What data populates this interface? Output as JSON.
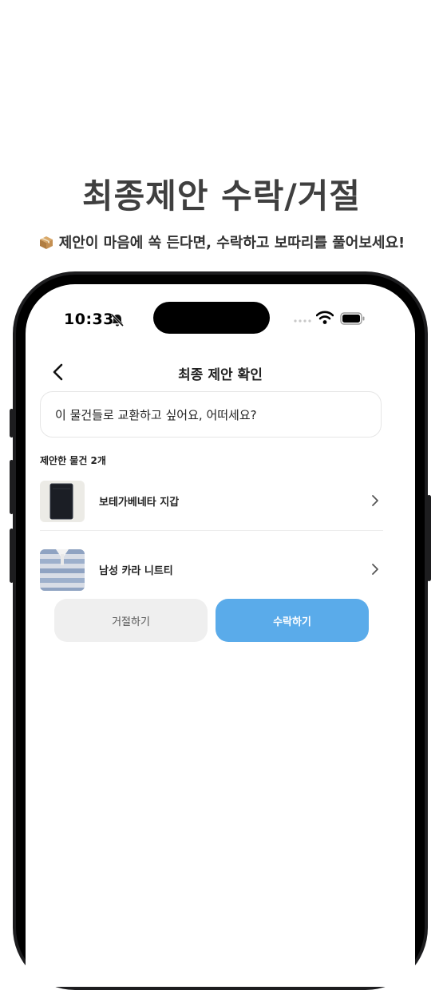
{
  "promo": {
    "title": "최종제안 수락/거절",
    "subtitle": "제안이 마음에 쏙 든다면, 수락하고 보따리를 풀어보세요!",
    "subtitle_icon": "package-icon"
  },
  "status_bar": {
    "time": "10:33",
    "icons": [
      "bell-off-icon",
      "signal-icon",
      "wifi-icon",
      "battery-icon"
    ]
  },
  "nav": {
    "back_icon": "chevron-left-icon",
    "title": "최종 제안 확인"
  },
  "message": {
    "text": "이 물건들로 교환하고 싶어요, 어떠세요?"
  },
  "items_section": {
    "label": "제안한 물건 2개",
    "items": [
      {
        "name": "보테가베네타 지갑",
        "thumb": "wallet-photo"
      },
      {
        "name": "남성 카라 니트티",
        "thumb": "knit-shirt-photo"
      }
    ]
  },
  "actions": {
    "reject_label": "거절하기",
    "accept_label": "수락하기"
  },
  "colors": {
    "accent": "#5aabea",
    "reject_bg": "#efefef",
    "title_text": "#3f3f3f",
    "phone_frame": "#1d1d1f"
  }
}
